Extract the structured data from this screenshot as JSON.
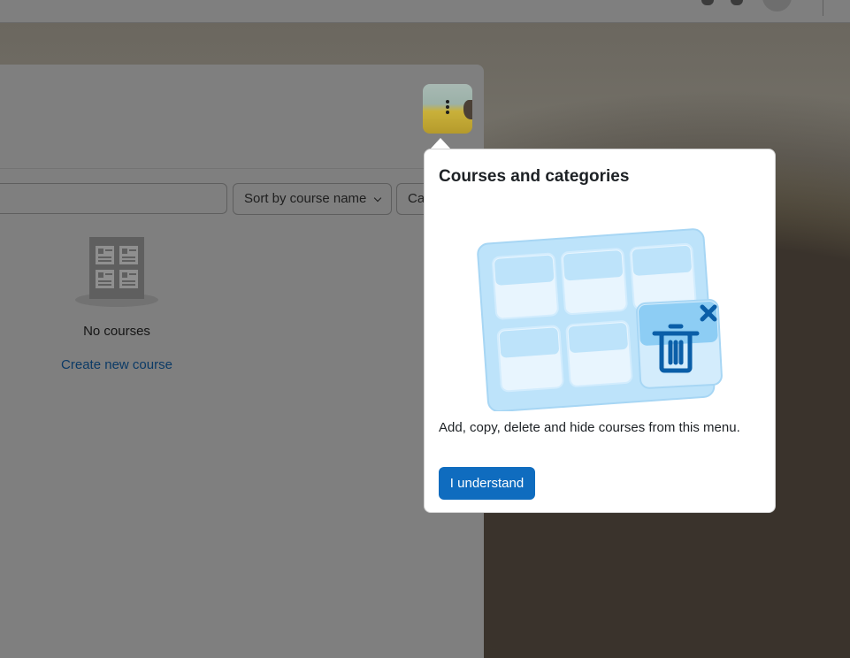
{
  "sort": {
    "label": "Sort by course name"
  },
  "category": {
    "label": "Ca"
  },
  "empty_state": {
    "message": "No courses",
    "create_link": "Create new course"
  },
  "tour": {
    "title": "Courses and categories",
    "body": "Add, copy, delete and hide courses from this menu.",
    "button_label": "I understand"
  },
  "colors": {
    "primary": "#0f6cbf",
    "link": "#0b3a66",
    "illustration_light": "#bde3fa",
    "illustration_dark": "#0a5ea8"
  },
  "icons": {
    "course_menu": "kebab-icon",
    "illustration_delete": "trash-icon",
    "illustration_close": "close-icon"
  }
}
